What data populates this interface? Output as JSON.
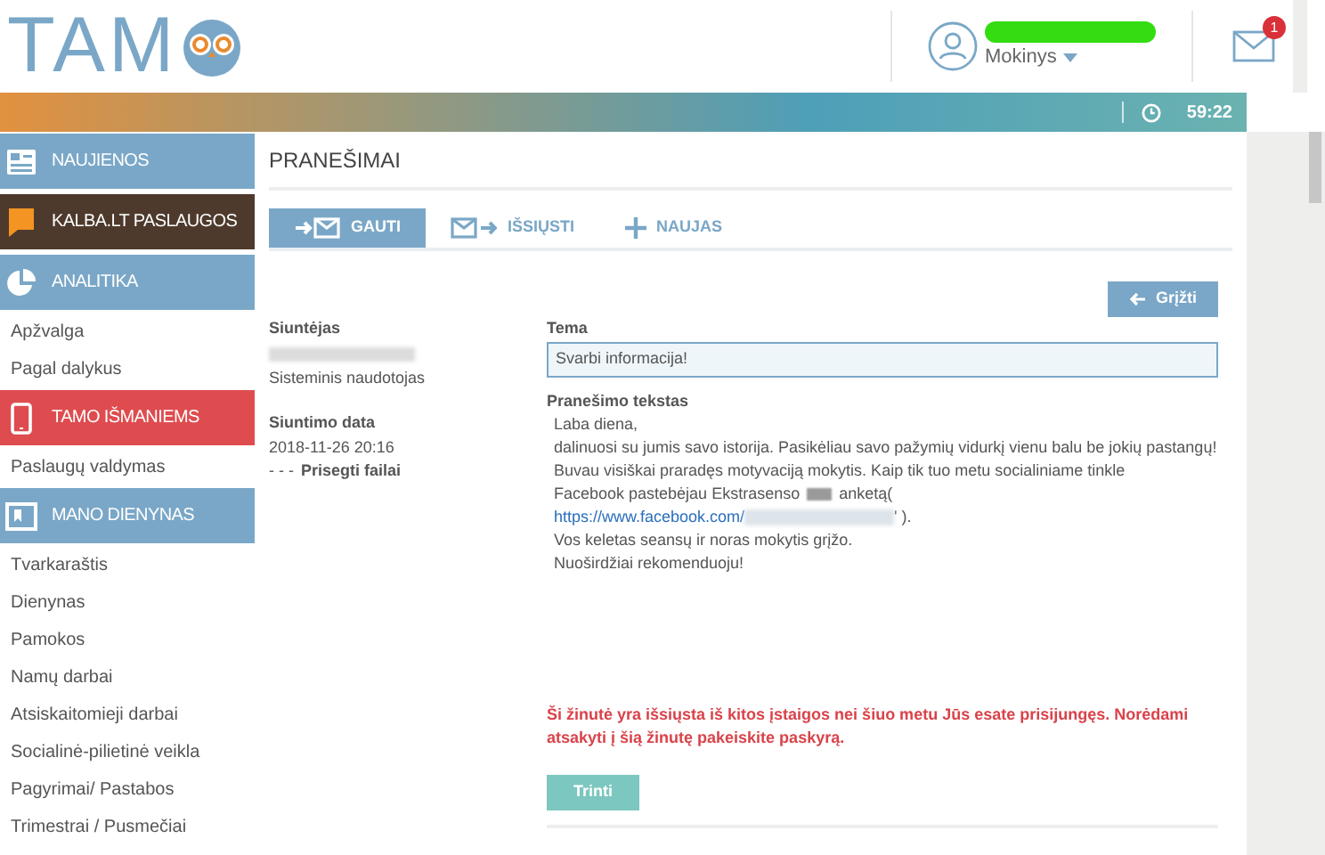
{
  "header": {
    "logo": "TAM",
    "user_role": "Mokinys",
    "unread_count": "1"
  },
  "top_bar": {
    "timer": "59:22"
  },
  "sidebar": {
    "items": [
      {
        "kind": "section",
        "label": "NAUJIENOS",
        "color": "#7aa7c7"
      },
      {
        "kind": "section",
        "label": "KALBA.LT PASLAUGOS",
        "color": "#4e3a2c"
      },
      {
        "kind": "section",
        "label": "ANALITIKA",
        "color": "#7aa7c7"
      },
      {
        "kind": "link",
        "label": "Apžvalga"
      },
      {
        "kind": "link",
        "label": "Pagal dalykus"
      },
      {
        "kind": "section",
        "label": "TAMO IŠMANIEMS",
        "color": "#de4c4f"
      },
      {
        "kind": "link",
        "label": "Paslaugų valdymas"
      },
      {
        "kind": "section",
        "label": "MANO DIENYNAS",
        "color": "#7aa7c7"
      },
      {
        "kind": "link",
        "label": "Tvarkaraštis"
      },
      {
        "kind": "link",
        "label": "Dienynas"
      },
      {
        "kind": "link",
        "label": "Pamokos"
      },
      {
        "kind": "link",
        "label": "Namų darbai"
      },
      {
        "kind": "link",
        "label": "Atsiskaitomieji darbai"
      },
      {
        "kind": "link",
        "label": "Socialinė-pilietinė veikla"
      },
      {
        "kind": "link",
        "label": "Pagyrimai/ Pastabos"
      },
      {
        "kind": "link",
        "label": "Trimestrai / Pusmečiai"
      }
    ]
  },
  "page_title": "PRANEŠIMAI",
  "tabs": [
    {
      "label": "GAUTI",
      "selected": true
    },
    {
      "label": "IŠSIŲSTI",
      "selected": false
    },
    {
      "label": "NAUJAS",
      "selected": false
    }
  ],
  "back_button": "Grįžti",
  "sender": {
    "label": "Siuntėjas",
    "role": "Sisteminis naudotojas"
  },
  "sent_date": {
    "label": "Siuntimo data",
    "value": "2018-11-26 20:16",
    "attachments_prefix": "- - -",
    "attachments": "Prisegti failai"
  },
  "subject": {
    "label": "Tema",
    "value": "Svarbi informacija!"
  },
  "body": {
    "label": "Pranešimo tekstas",
    "lines": [
      {
        "kind": "text",
        "text": "Laba diena,"
      },
      {
        "kind": "text",
        "text": "dalinuosi su jumis savo istorija. Pasikėliau savo pažymių vidurkį vienu balu be jokių pastangų!"
      },
      {
        "kind": "text",
        "text": "Buvau visiškai praradęs motyvaciją mokytis. Kaip tik tuo metu socialiniame tinkle"
      },
      {
        "kind": "redacted",
        "text": "Facebook pastebėjau Ekstrasenso",
        "after": "anketą("
      },
      {
        "kind": "link",
        "text": "https://www.facebook.com/",
        "after": "' )."
      },
      {
        "kind": "text",
        "text": "Vos keletas seansų ir noras mokytis grįžo."
      },
      {
        "kind": "text",
        "text": "Nuoširdžiai rekomenduoju!"
      }
    ]
  },
  "warning": "Ši žinutė yra išsiųsta iš kitos įstaigos nei šiuo metu Jūs esate prisijungęs. Norėdami atsakyti į šią žinutę pakeiskite paskyrą.",
  "delete_button": "Trinti"
}
